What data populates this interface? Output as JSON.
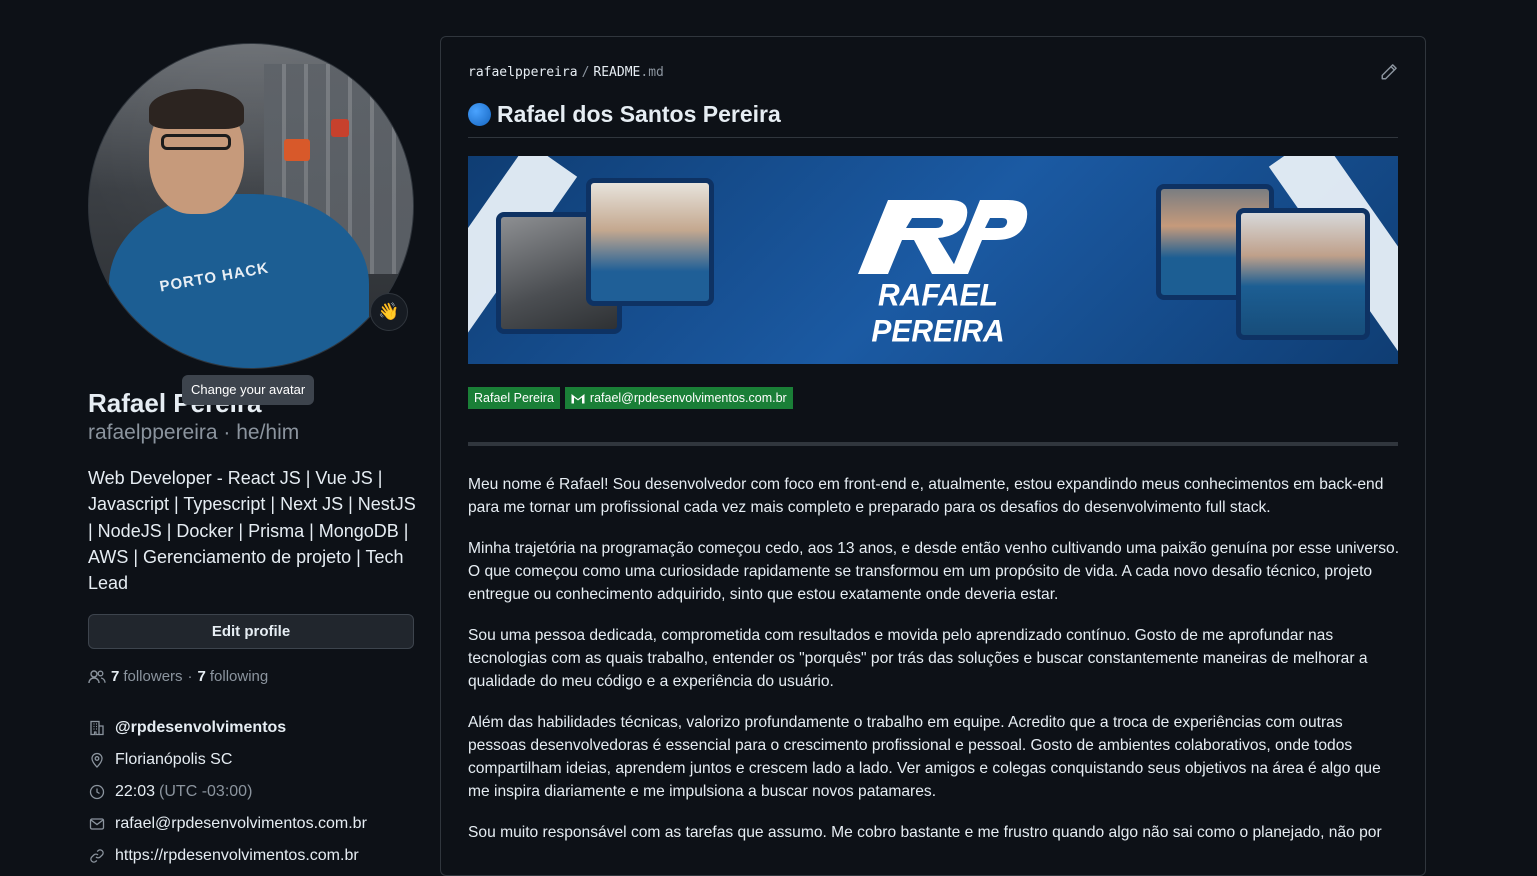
{
  "profile": {
    "avatar_tooltip": "Change your avatar",
    "avatar_shirt_text": "PORTO HACK",
    "status_emoji": "👋",
    "name": "Rafael Pereira",
    "login_line": "rafaelppereira · he/him",
    "bio": "Web Developer - React JS | Vue JS | Javascript | Typescript | Next JS | NestJS | NodeJS | Docker | Prisma | MongoDB | AWS | Gerenciamento de projeto | Tech Lead",
    "edit_button": "Edit profile",
    "followers_count": "7",
    "followers_label": "followers",
    "following_count": "7",
    "following_label": "following",
    "company": "@rpdesenvolvimentos",
    "location": "Florianópolis SC",
    "local_time": "22:03",
    "timezone": "(UTC -03:00)",
    "email": "rafael@rpdesenvolvimentos.com.br",
    "website": "https://rpdesenvolvimentos.com.br"
  },
  "readme": {
    "owner": "rafaelppereira",
    "separator": "/",
    "file_base": "README",
    "file_ext": ".md",
    "title": "Rafael dos Santos Pereira",
    "banner_name": "RAFAEL PEREIRA",
    "badges": {
      "name": "Rafael Pereira",
      "email": "rafael@rpdesenvolvimentos.com.br"
    },
    "paragraphs": [
      "Meu nome é Rafael! Sou desenvolvedor com foco em front-end e, atualmente, estou expandindo meus conhecimentos em back-end para me tornar um profissional cada vez mais completo e preparado para os desafios do desenvolvimento full stack.",
      "Minha trajetória na programação começou cedo, aos 13 anos, e desde então venho cultivando uma paixão genuína por esse universo. O que começou como uma curiosidade rapidamente se transformou em um propósito de vida. A cada novo desafio técnico, projeto entregue ou conhecimento adquirido, sinto que estou exatamente onde deveria estar.",
      "Sou uma pessoa dedicada, comprometida com resultados e movida pelo aprendizado contínuo. Gosto de me aprofundar nas tecnologias com as quais trabalho, entender os \"porquês\" por trás das soluções e buscar constantemente maneiras de melhorar a qualidade do meu código e a experiência do usuário.",
      "Além das habilidades técnicas, valorizo profundamente o trabalho em equipe. Acredito que a troca de experiências com outras pessoas desenvolvedoras é essencial para o crescimento profissional e pessoal. Gosto de ambientes colaborativos, onde todos compartilham ideias, aprendem juntos e crescem lado a lado. Ver amigos e colegas conquistando seus objetivos na área é algo que me inspira diariamente e me impulsiona a buscar novos patamares.",
      "Sou muito responsável com as tarefas que assumo. Me cobro bastante e me frustro quando algo não sai como o planejado, não por"
    ]
  },
  "colors": {
    "background": "#0d1117",
    "border": "#30363d",
    "text": "#e6edf3",
    "muted": "#8b949e",
    "badge_green": "#1a7f37",
    "banner_blue": "#1b5aa3"
  }
}
